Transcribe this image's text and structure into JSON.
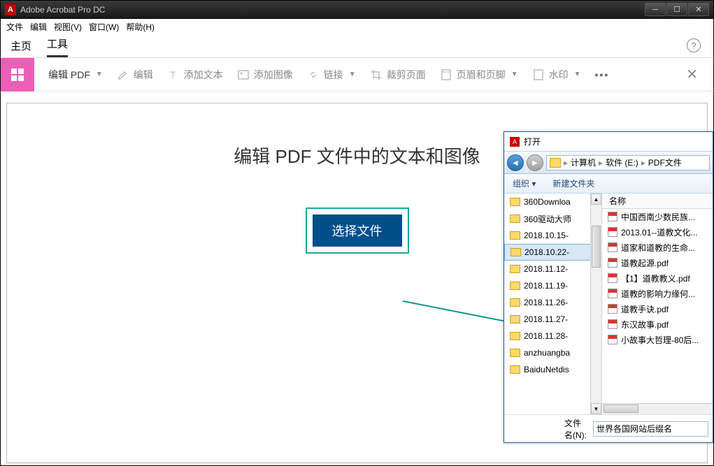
{
  "window": {
    "title": "Adobe Acrobat Pro DC"
  },
  "menubar": [
    "文件",
    "编辑",
    "视图(V)",
    "窗口(W)",
    "帮助(H)"
  ],
  "apptabs": {
    "home": "主页",
    "tools": "工具"
  },
  "toolbar": {
    "editpdf": "编辑 PDF",
    "edit": "编辑",
    "addtext": "添加文本",
    "addimage": "添加图像",
    "link": "链接",
    "crop": "裁剪页面",
    "header": "页眉和页脚",
    "watermark": "水印"
  },
  "main": {
    "heading": "编辑 PDF 文件中的文本和图像",
    "choose": "选择文件"
  },
  "dialog": {
    "title": "打开",
    "breadcrumb": [
      "计算机",
      "软件 (E:)",
      "PDF文件"
    ],
    "organize": "组织",
    "newfolder": "新建文件夹",
    "name_header": "名称",
    "folders": [
      "360Downloa",
      "360驱动大师",
      "2018.10.15-",
      "2018.10.22-",
      "2018.11.12-",
      "2018.11.19-",
      "2018.11.26-",
      "2018.11.27-",
      "2018.11.28-",
      "anzhuangba",
      "BaiduNetdis"
    ],
    "selected_index": 3,
    "files": [
      "中国西南少数民族...",
      "2013.01--道教文化...",
      "道家和道教的生命...",
      "道教起源.pdf",
      "【1】道教教义.pdf",
      "道教的影响力缘何...",
      "道教手诀.pdf",
      "东汉故事.pdf",
      "小故事大哲理-80后..."
    ],
    "filename_label": "文件名(N):",
    "filename_value": "世界各国网站后缀名"
  }
}
